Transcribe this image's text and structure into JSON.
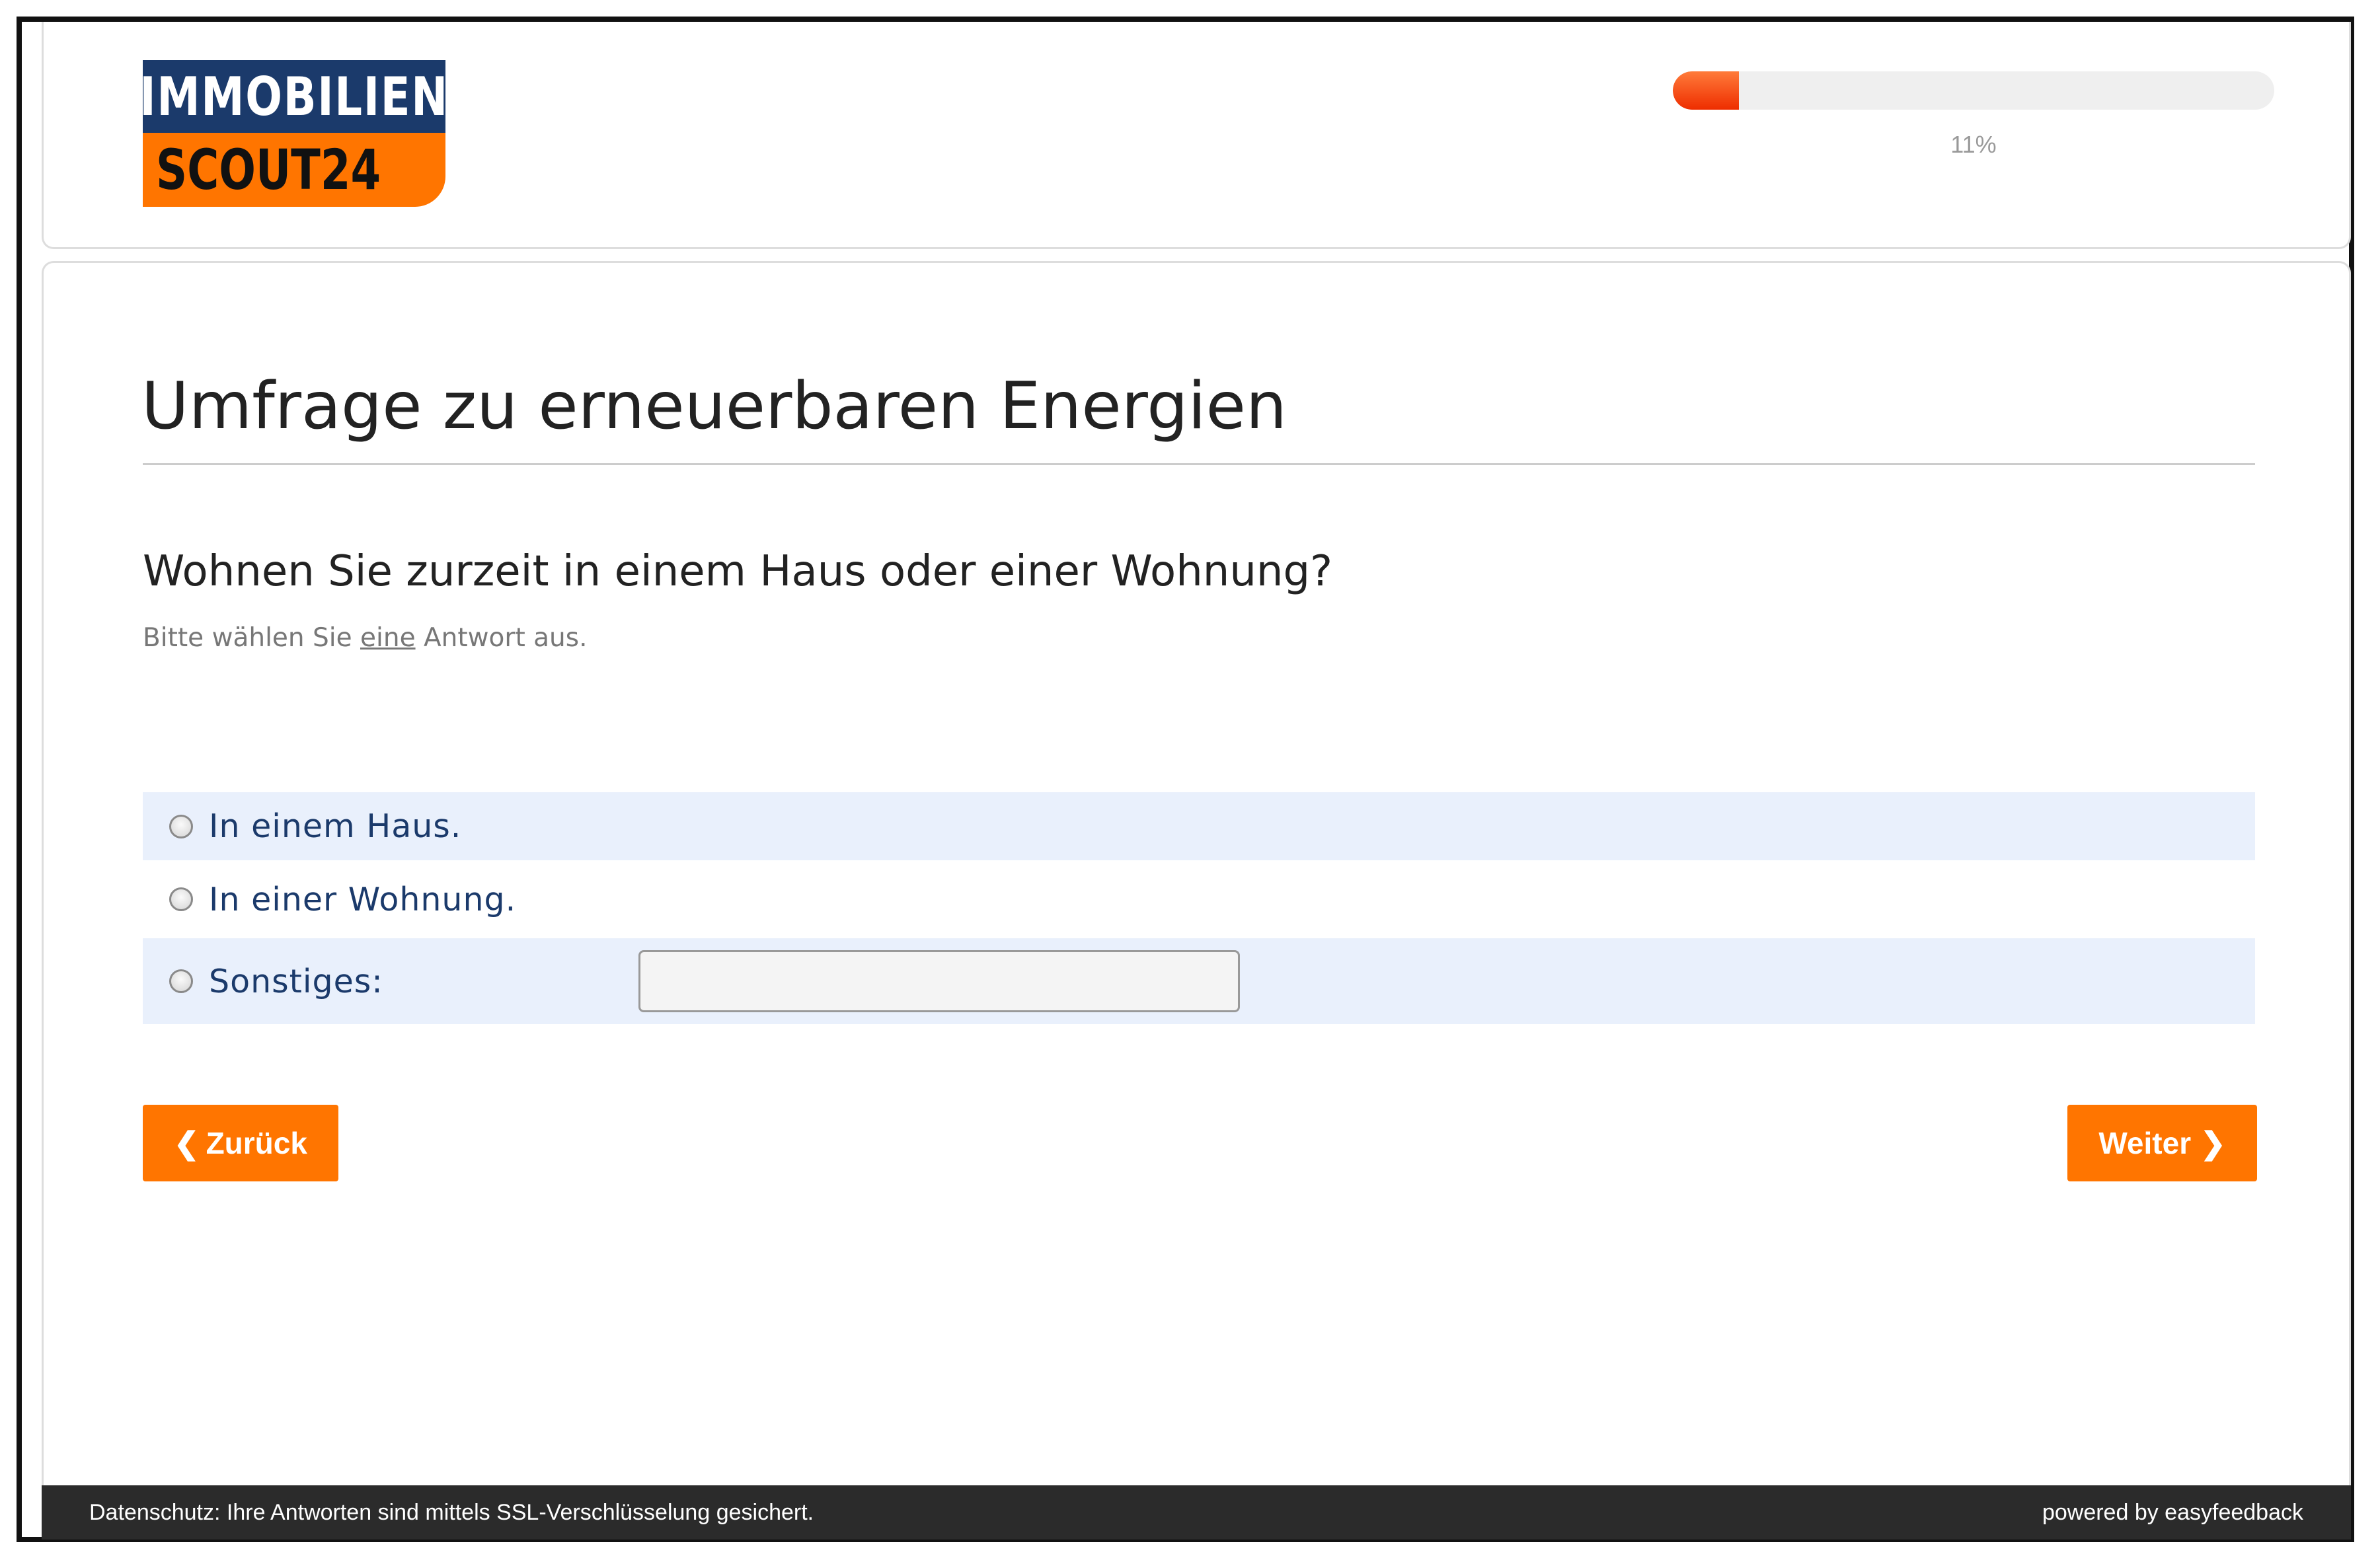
{
  "brand": {
    "logo_line1": "IMMOBILIEN",
    "logo_line2": "SCOUT24",
    "colors": {
      "navy": "#1b3a6b",
      "orange": "#ff7500"
    }
  },
  "progress": {
    "value_percent": 11,
    "label": "11%"
  },
  "survey": {
    "title": "Umfrage zu erneuerbaren Energien",
    "question": "Wohnen Sie zurzeit in einem Haus oder einer Wohnung?",
    "hint_before": "Bitte wählen Sie ",
    "hint_emphasis": "eine",
    "hint_after": " Antwort aus.",
    "options": [
      {
        "label": "In einem Haus.",
        "selected": false
      },
      {
        "label": "In einer Wohnung.",
        "selected": false
      },
      {
        "label": "Sonstiges:",
        "selected": false
      }
    ],
    "other_value": ""
  },
  "nav": {
    "back_label": "Zurück",
    "next_label": "Weiter",
    "back_icon": "chevron-left-icon",
    "next_icon": "chevron-right-icon"
  },
  "footer": {
    "privacy_text": "Datenschutz: Ihre Antworten sind mittels SSL-Verschlüsselung gesichert.",
    "powered_text": "powered by easyfeedback"
  }
}
